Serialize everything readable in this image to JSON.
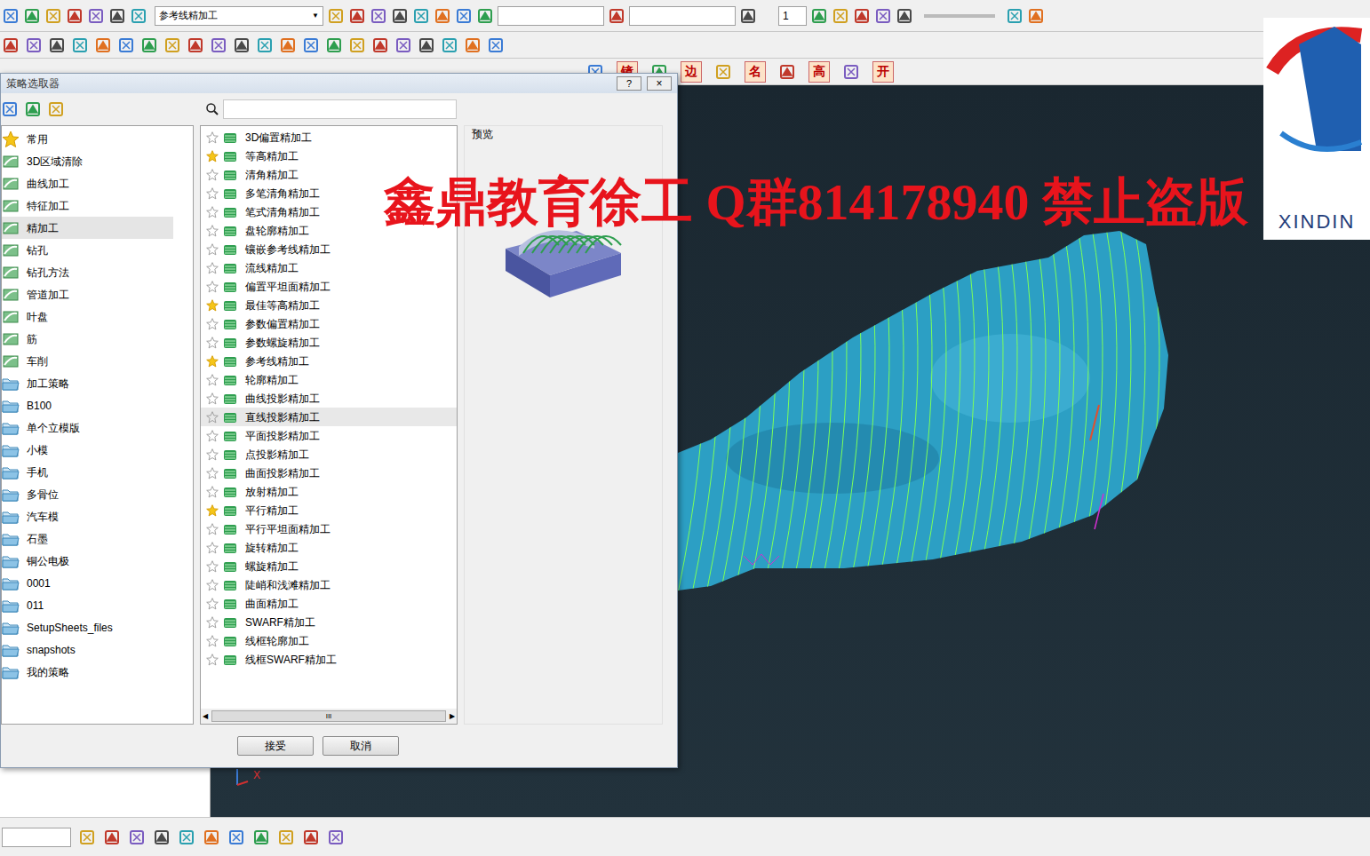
{
  "app": {
    "toolbar_dropdown": "参考线精加工",
    "toolbar_counter": "1",
    "icon_glyphs": [
      "镜",
      "边",
      "名",
      "高",
      "开"
    ]
  },
  "dialog": {
    "title": "策略选取器",
    "help_button": "?",
    "close_button": "×",
    "search": {
      "placeholder": ""
    },
    "categories": [
      {
        "label": "常用",
        "kind": "star",
        "selected": false
      },
      {
        "label": "3D区域清除",
        "kind": "icon",
        "selected": false
      },
      {
        "label": "曲线加工",
        "kind": "icon",
        "selected": false
      },
      {
        "label": "特征加工",
        "kind": "icon",
        "selected": false
      },
      {
        "label": "精加工",
        "kind": "icon",
        "selected": true
      },
      {
        "label": "钻孔",
        "kind": "icon",
        "selected": false
      },
      {
        "label": "钻孔方法",
        "kind": "icon",
        "selected": false
      },
      {
        "label": "管道加工",
        "kind": "icon",
        "selected": false
      },
      {
        "label": "叶盘",
        "kind": "icon",
        "selected": false
      },
      {
        "label": "筋",
        "kind": "icon",
        "selected": false
      },
      {
        "label": "车削",
        "kind": "icon",
        "selected": false
      },
      {
        "label": "加工策略",
        "kind": "folder",
        "selected": false
      },
      {
        "label": "B100",
        "kind": "folder",
        "selected": false
      },
      {
        "label": "单个立模版",
        "kind": "folder",
        "selected": false
      },
      {
        "label": "小模",
        "kind": "folder",
        "selected": false
      },
      {
        "label": "手机",
        "kind": "folder",
        "selected": false
      },
      {
        "label": "多骨位",
        "kind": "folder",
        "selected": false
      },
      {
        "label": "汽车模",
        "kind": "folder",
        "selected": false
      },
      {
        "label": "石墨",
        "kind": "folder",
        "selected": false
      },
      {
        "label": "铜公电极",
        "kind": "folder",
        "selected": false
      },
      {
        "label": "0001",
        "kind": "folder",
        "selected": false
      },
      {
        "label": "011",
        "kind": "folder",
        "selected": false
      },
      {
        "label": "SetupSheets_files",
        "kind": "folder",
        "selected": false
      },
      {
        "label": "snapshots",
        "kind": "folder",
        "selected": false
      },
      {
        "label": "我的策略",
        "kind": "folder",
        "selected": false
      }
    ],
    "strategies": [
      {
        "label": "3D偏置精加工",
        "favorite": false,
        "selected": false
      },
      {
        "label": "等高精加工",
        "favorite": true,
        "selected": false
      },
      {
        "label": "清角精加工",
        "favorite": false,
        "selected": false
      },
      {
        "label": "多笔清角精加工",
        "favorite": false,
        "selected": false
      },
      {
        "label": "笔式清角精加工",
        "favorite": false,
        "selected": false
      },
      {
        "label": "盘轮廓精加工",
        "favorite": false,
        "selected": false
      },
      {
        "label": "镶嵌参考线精加工",
        "favorite": false,
        "selected": false
      },
      {
        "label": "流线精加工",
        "favorite": false,
        "selected": false
      },
      {
        "label": "偏置平坦面精加工",
        "favorite": false,
        "selected": false
      },
      {
        "label": "最佳等高精加工",
        "favorite": true,
        "selected": false
      },
      {
        "label": "参数偏置精加工",
        "favorite": false,
        "selected": false
      },
      {
        "label": "参数螺旋精加工",
        "favorite": false,
        "selected": false
      },
      {
        "label": "参考线精加工",
        "favorite": true,
        "selected": false
      },
      {
        "label": "轮廓精加工",
        "favorite": false,
        "selected": false
      },
      {
        "label": "曲线投影精加工",
        "favorite": false,
        "selected": false
      },
      {
        "label": "直线投影精加工",
        "favorite": false,
        "selected": true
      },
      {
        "label": "平面投影精加工",
        "favorite": false,
        "selected": false
      },
      {
        "label": "点投影精加工",
        "favorite": false,
        "selected": false
      },
      {
        "label": "曲面投影精加工",
        "favorite": false,
        "selected": false
      },
      {
        "label": "放射精加工",
        "favorite": false,
        "selected": false
      },
      {
        "label": "平行精加工",
        "favorite": true,
        "selected": false
      },
      {
        "label": "平行平坦面精加工",
        "favorite": false,
        "selected": false
      },
      {
        "label": "旋转精加工",
        "favorite": false,
        "selected": false
      },
      {
        "label": "螺旋精加工",
        "favorite": false,
        "selected": false
      },
      {
        "label": "陡峭和浅滩精加工",
        "favorite": false,
        "selected": false
      },
      {
        "label": "曲面精加工",
        "favorite": false,
        "selected": false
      },
      {
        "label": "SWARF精加工",
        "favorite": false,
        "selected": false
      },
      {
        "label": "线框轮廓加工",
        "favorite": false,
        "selected": false
      },
      {
        "label": "线框SWARF精加工",
        "favorite": false,
        "selected": false
      }
    ],
    "preview_label": "预览",
    "scrollbar_grip": "III",
    "buttons": [
      "接受",
      "取消"
    ]
  },
  "watermark": "鑫鼎教育徐工 Q群814178940 禁止盗版",
  "logo": {
    "text": "XINDIN"
  },
  "viewport": {
    "axis_label": "X"
  }
}
